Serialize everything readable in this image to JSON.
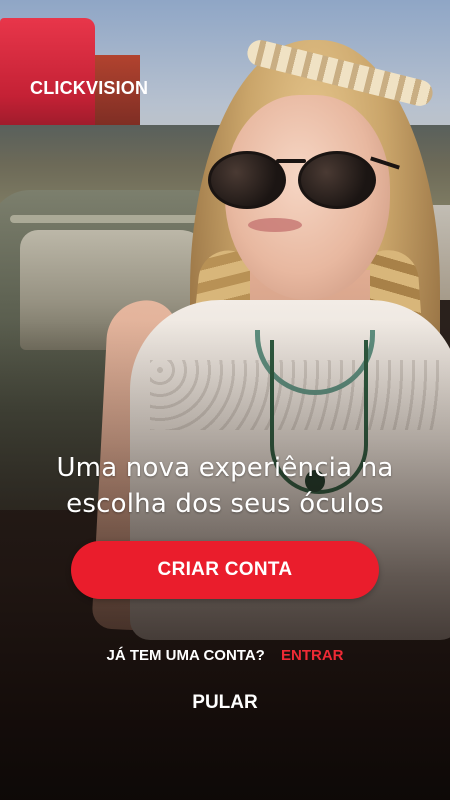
{
  "brand": {
    "logo_text": "CLICKVISION"
  },
  "hero": {
    "image": "hero-photo",
    "tagline_line1": "Uma nova experiência na",
    "tagline_line2": "escolha dos seus óculos"
  },
  "actions": {
    "create_account_label": "CRIAR CONTA",
    "have_account_question": "JÁ TEM UMA CONTA?",
    "login_label": "ENTRAR",
    "skip_label": "PULAR"
  },
  "colors": {
    "accent": "#EA1D2C",
    "text_on_dark": "#FFFFFF"
  }
}
